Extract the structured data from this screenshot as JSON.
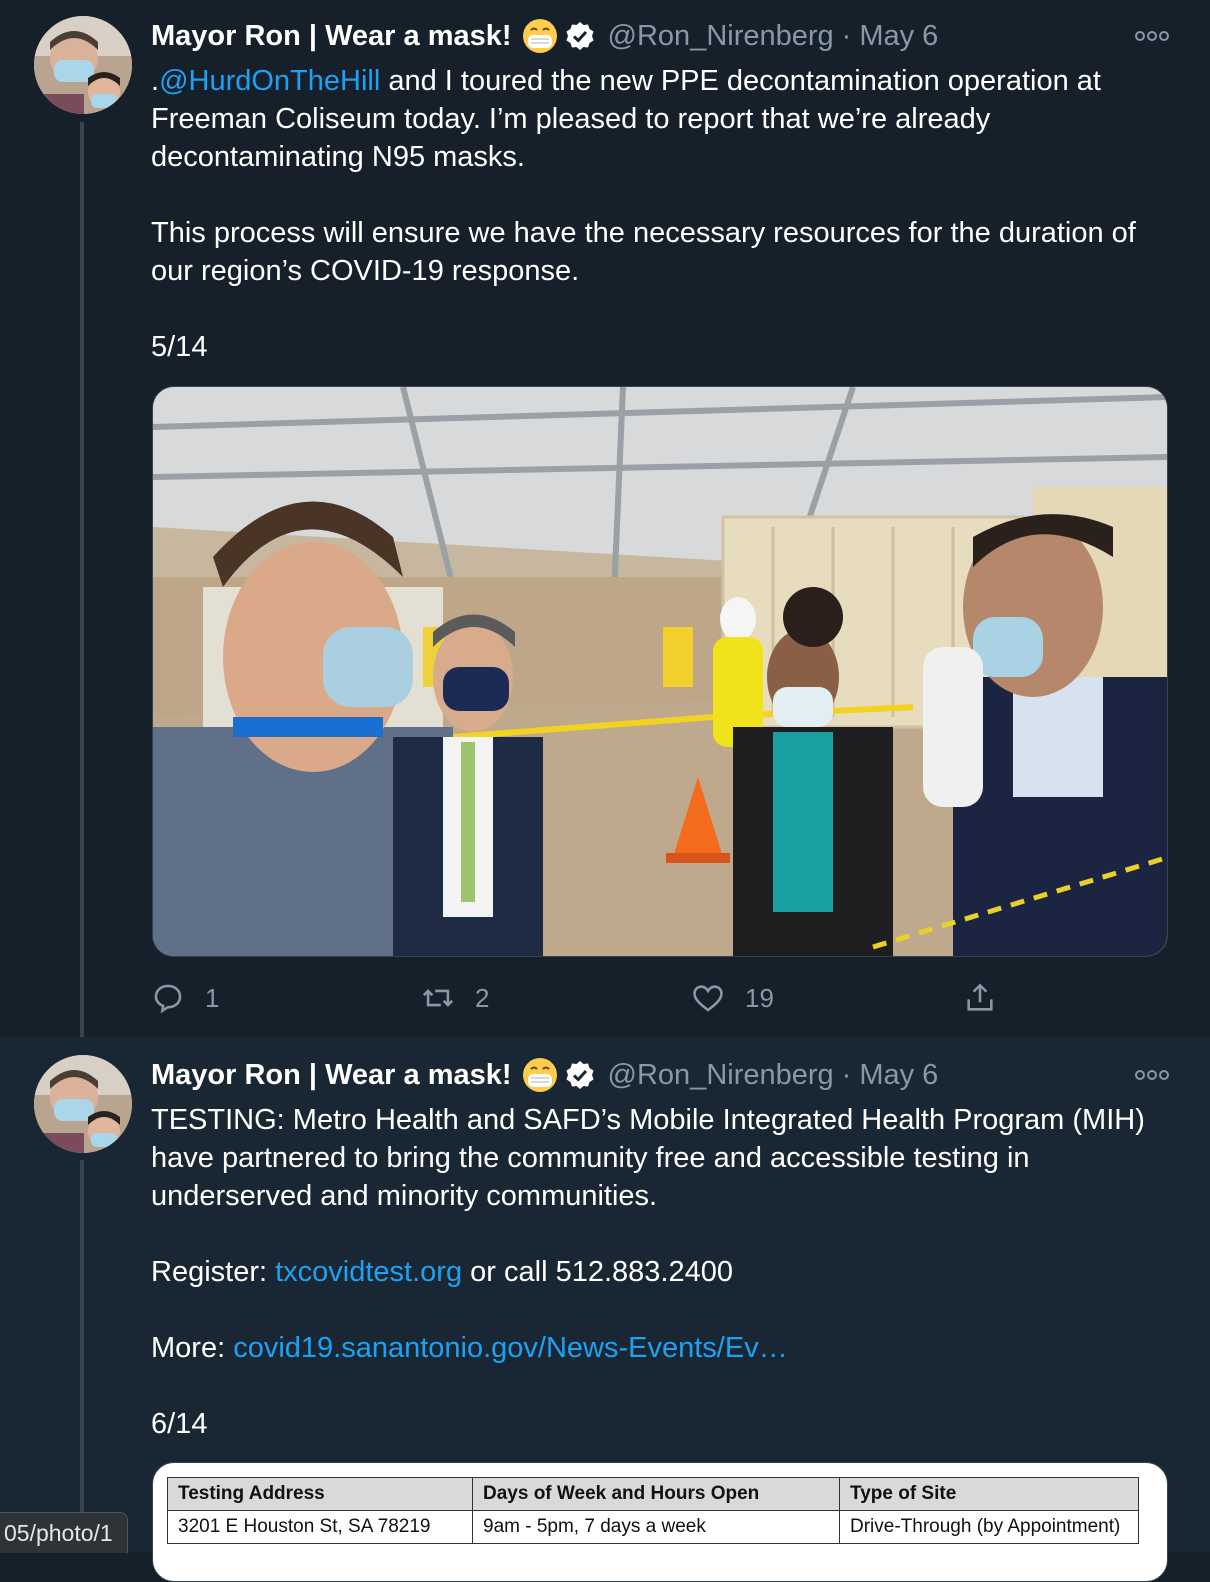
{
  "tweets": [
    {
      "author_name": "Mayor Ron | Wear a mask!",
      "emoji_icon": "face-with-medical-mask",
      "handle": "@Ron_Nirenberg",
      "separator": "·",
      "date": "May 6",
      "text": {
        "line1_prefix": ".",
        "mention": "@HurdOnTheHill",
        "line1_rest": " and I toured the new PPE decontamination operation at Freeman Coliseum today. I’m pleased to report that we’re already decontaminating N95 masks.",
        "para2": "This process will ensure we have the necessary resources for the duration of our region’s COVID-19 response.",
        "thread_index": "5/14"
      },
      "photo_alt_icon": "photo-ppe-decontamination-tour",
      "actions": {
        "reply_count": "1",
        "retweet_count": "2",
        "like_count": "19"
      }
    },
    {
      "author_name": "Mayor Ron | Wear a mask!",
      "emoji_icon": "face-with-medical-mask",
      "handle": "@Ron_Nirenberg",
      "separator": "·",
      "date": "May 6",
      "text": {
        "para1": "TESTING: Metro Health and SAFD’s Mobile Integrated Health Program (MIH) have partnered to bring the community free and accessible testing in underserved and minority communities.",
        "register_label": "Register: ",
        "register_link": "txcovidtest.org",
        "register_rest": " or call 512.883.2400",
        "more_label": "More: ",
        "more_link": "covid19.sanantonio.gov/News-Events/Ev…",
        "thread_index": "6/14"
      },
      "table": {
        "headers": [
          "Testing Address",
          "Days of Week and Hours Open",
          "Type of Site"
        ],
        "rows": [
          [
            "3201 E Houston St, SA 78219",
            "9am - 5pm, 7 days a week",
            "Drive-Through (by Appointment)"
          ]
        ]
      }
    }
  ],
  "status_url": "05/photo/1",
  "colors": {
    "background": "#15202b",
    "highlight_background": "#192734",
    "link": "#1da1f2",
    "muted": "#8899a6"
  }
}
